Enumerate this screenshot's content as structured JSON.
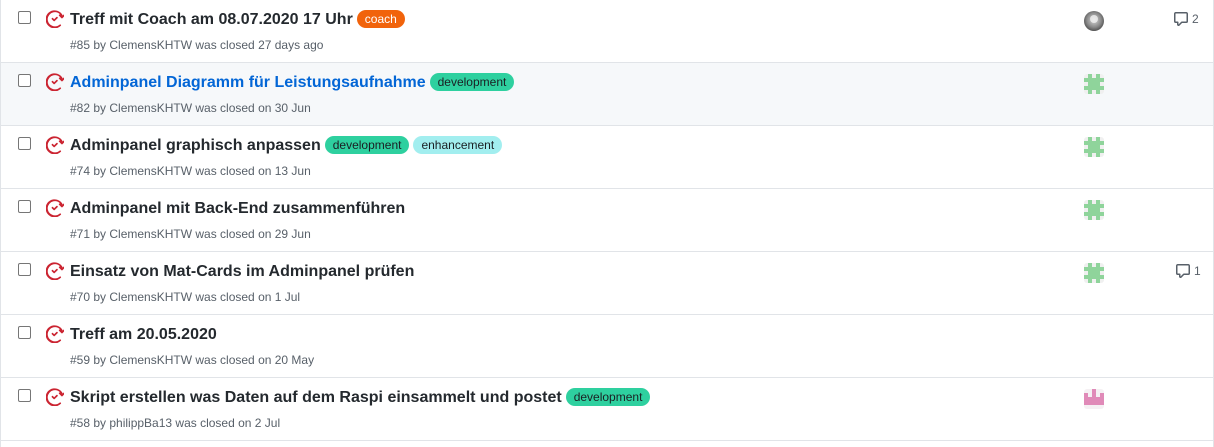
{
  "colors": {
    "closed_icon": "#cb2431",
    "link": "#0366d6",
    "label_coach": "#f1630b",
    "label_development": "#2ed09f",
    "label_enhancement": "#a2eeef"
  },
  "issues": [
    {
      "title": "Treff mit Coach am 08.07.2020 17 Uhr",
      "labels": [
        "coach"
      ],
      "meta": "#85 by ClemensKHTW was closed 27 days ago",
      "comments": "2",
      "avatar": "photo-avatar"
    },
    {
      "title": "Adminpanel Diagramm für Leistungsaufnahme",
      "labels": [
        "development"
      ],
      "meta": "#82 by ClemensKHTW was closed on 30 Jun",
      "comments": "",
      "avatar": "green-identicon"
    },
    {
      "title": "Adminpanel graphisch anpassen",
      "labels": [
        "development",
        "enhancement"
      ],
      "meta": "#74 by ClemensKHTW was closed on 13 Jun",
      "comments": "",
      "avatar": "green-identicon"
    },
    {
      "title": "Adminpanel mit Back-End zusammenführen",
      "labels": [],
      "meta": "#71 by ClemensKHTW was closed on 29 Jun",
      "comments": "",
      "avatar": "green-identicon"
    },
    {
      "title": "Einsatz von Mat-Cards im Adminpanel prüfen",
      "labels": [],
      "meta": "#70 by ClemensKHTW was closed on 1 Jul",
      "comments": "1",
      "avatar": "green-identicon"
    },
    {
      "title": "Treff am 20.05.2020",
      "labels": [],
      "meta": "#59 by ClemensKHTW was closed on 20 May",
      "comments": "",
      "avatar": ""
    },
    {
      "title": "Skript erstellen was Daten auf dem Raspi einsammelt und postet",
      "labels": [
        "development"
      ],
      "meta": "#58 by philippBa13 was closed on 2 Jul",
      "comments": "",
      "avatar": "pink-identicon"
    }
  ]
}
